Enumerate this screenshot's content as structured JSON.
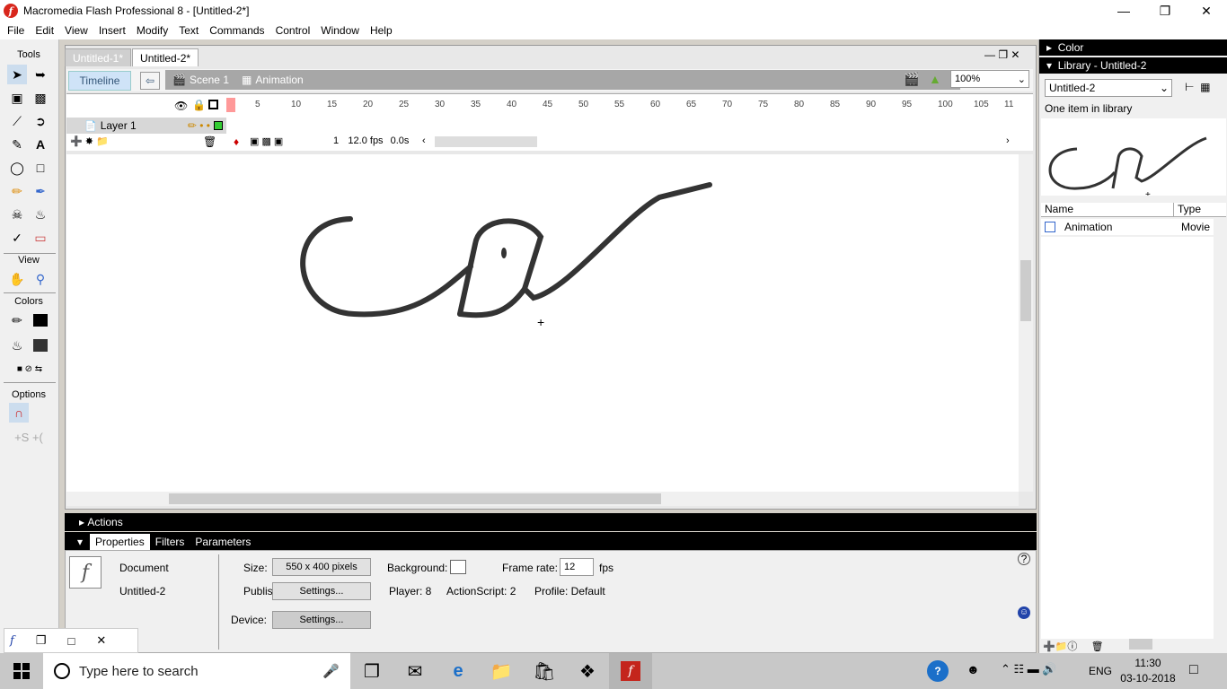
{
  "window": {
    "title": "Macromedia Flash Professional 8 - [Untitled-2*]"
  },
  "menu": [
    "File",
    "Edit",
    "View",
    "Insert",
    "Modify",
    "Text",
    "Commands",
    "Control",
    "Window",
    "Help"
  ],
  "tools": {
    "header": "Tools",
    "view_header": "View",
    "colors_header": "Colors",
    "options_header": "Options"
  },
  "doc_tabs": [
    "Untitled-1*",
    "Untitled-2*"
  ],
  "editbar": {
    "timeline": "Timeline",
    "scene": "Scene 1",
    "symbol": "Animation",
    "zoom": "100%"
  },
  "timeline": {
    "ruler": [
      "5",
      "10",
      "15",
      "20",
      "25",
      "30",
      "35",
      "40",
      "45",
      "50",
      "55",
      "60",
      "65",
      "70",
      "75",
      "80",
      "85",
      "90",
      "95",
      "100",
      "105",
      "11"
    ],
    "layer": "Layer 1",
    "frame": "1",
    "fps": "12.0 fps",
    "time": "0.0s"
  },
  "panels": {
    "actions": "Actions",
    "prop_tabs": [
      "Properties",
      "Filters",
      "Parameters"
    ],
    "doc_type": "Document",
    "doc_name": "Untitled-2",
    "size_label": "Size:",
    "size_value": "550 x 400 pixels",
    "bg_label": "Background:",
    "fr_label": "Frame rate:",
    "fr_value": "12",
    "fps": "fps",
    "publish_label": "Publish:",
    "settings": "Settings...",
    "player": "Player: 8",
    "actionscript": "ActionScript:  2",
    "profile": "Profile:  Default",
    "device_label": "Device:"
  },
  "library": {
    "color_header": "Color",
    "header": "Library - Untitled-2",
    "dropdown": "Untitled-2",
    "count": "One item in library",
    "col_name": "Name",
    "col_type": "Type",
    "item_name": "Animation",
    "item_type": "Movie"
  },
  "taskbar": {
    "search": "Type here to search",
    "lang": "ENG",
    "time": "11:30",
    "date": "03-10-2018"
  }
}
